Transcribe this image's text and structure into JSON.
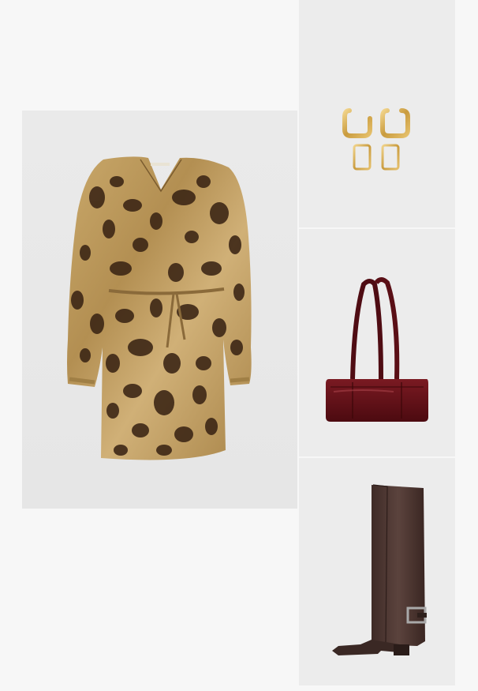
{
  "outfit": {
    "items": [
      {
        "name": "dress",
        "icon": "patterned-belted-mini-dress",
        "color": "#b8965a"
      },
      {
        "name": "earrings",
        "icon": "gold-square-hoop-earrings",
        "color": "#d4ad55"
      },
      {
        "name": "bag",
        "icon": "burgundy-shoulder-bag",
        "color": "#5e0f16"
      },
      {
        "name": "boots",
        "icon": "brown-fold-over-knee-boots",
        "color": "#4a3530"
      }
    ]
  },
  "colors": {
    "page_background": "#f7f7f7",
    "tile_background": "#ececec"
  }
}
